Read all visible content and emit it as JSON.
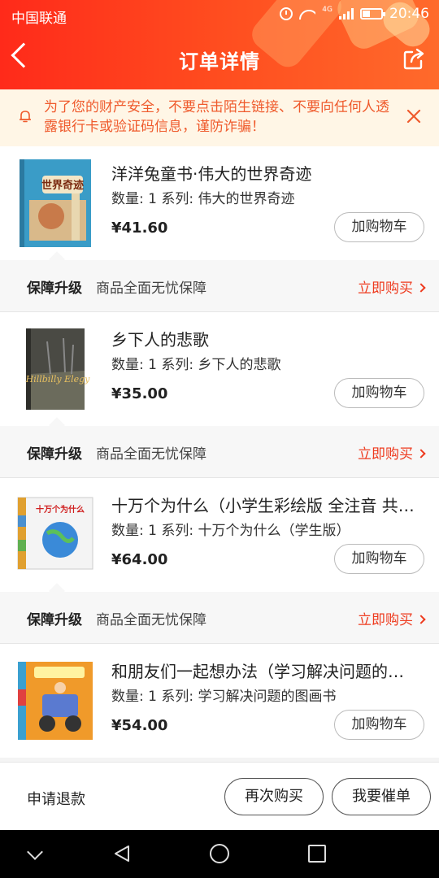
{
  "statusbar": {
    "carrier": "中国联通",
    "network": "4G",
    "time": "20:46"
  },
  "header": {
    "title": "订单详情"
  },
  "notice": {
    "text": "为了您的财产安全，不要点击陌生链接、不要向任何人透露银行卡或验证码信息，谨防诈骗！"
  },
  "items": [
    {
      "name": "洋洋兔童书·伟大的世界奇迹",
      "spec": "数量: 1 系列: 伟大的世界奇迹",
      "price": "¥41.60",
      "cart_label": "加购物车",
      "cover_text": "世界奇迹",
      "cover_color": "#3a9cc7"
    },
    {
      "name": "乡下人的悲歌",
      "spec": "数量: 1 系列: 乡下人的悲歌",
      "price": "¥35.00",
      "cart_label": "加购物车",
      "cover_text": "Hillbilly Elegy",
      "cover_color": "#4a4a44"
    },
    {
      "name": "十万个为什么（小学生彩绘版 全注音 共…",
      "spec": "数量: 1 系列: 十万个为什么（学生版）",
      "price": "¥64.00",
      "cart_label": "加购物车",
      "cover_text": "十万个为什么",
      "cover_color": "#e04040"
    },
    {
      "name": "和朋友们一起想办法（学习解决问题的…",
      "spec": "数量: 1 系列: 学习解决问题的图画书",
      "price": "¥54.00",
      "cart_label": "加购物车",
      "cover_text": "",
      "cover_color": "#f09a2a"
    }
  ],
  "guarantee": {
    "title": "保障升级",
    "desc": "商品全面无忧保障",
    "buy_label": "立即购买"
  },
  "bottom": {
    "refund_label": "申请退款",
    "rebuy_label": "再次购买",
    "urge_label": "我要催单"
  },
  "colors": {
    "accent": "#ee3a1e",
    "header_start": "#ff2a1a",
    "header_end": "#ff6a2b",
    "notice_bg": "#fff6e6",
    "notice_text": "#ef5a2c"
  }
}
